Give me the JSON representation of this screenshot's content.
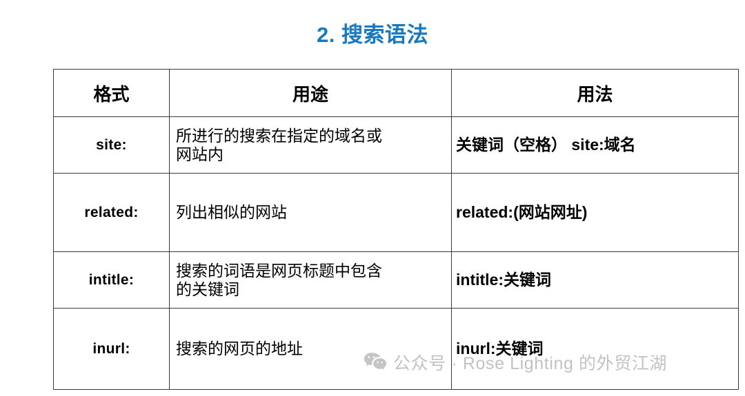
{
  "page": {
    "title": "2. 搜索语法",
    "title_color": "#1878c0",
    "background": "#ffffff"
  },
  "table": {
    "headers": {
      "format": "格式",
      "purpose": "用途",
      "usage": "用法"
    },
    "rows": [
      {
        "format": "site:",
        "purpose_lines": [
          "所进行的搜索在指定的域名或",
          "网站内"
        ],
        "usage": "关键词（空格） site:域名"
      },
      {
        "format": "related:",
        "purpose_lines": [
          "列出相似的网站"
        ],
        "usage": "related:(网站网址)"
      },
      {
        "format": "intitle:",
        "purpose_lines": [
          "搜索的词语是网页标题中包含",
          "的关键词"
        ],
        "usage": "intitle:关键词"
      },
      {
        "format": "inurl:",
        "purpose_lines": [
          "搜索的网页的地址"
        ],
        "usage": "inurl:关键词"
      }
    ]
  },
  "watermark": {
    "icon": "wechat-icon",
    "text": "公众号 · Rose Lighting 的外贸江湖",
    "color": "#c2c2c2"
  }
}
